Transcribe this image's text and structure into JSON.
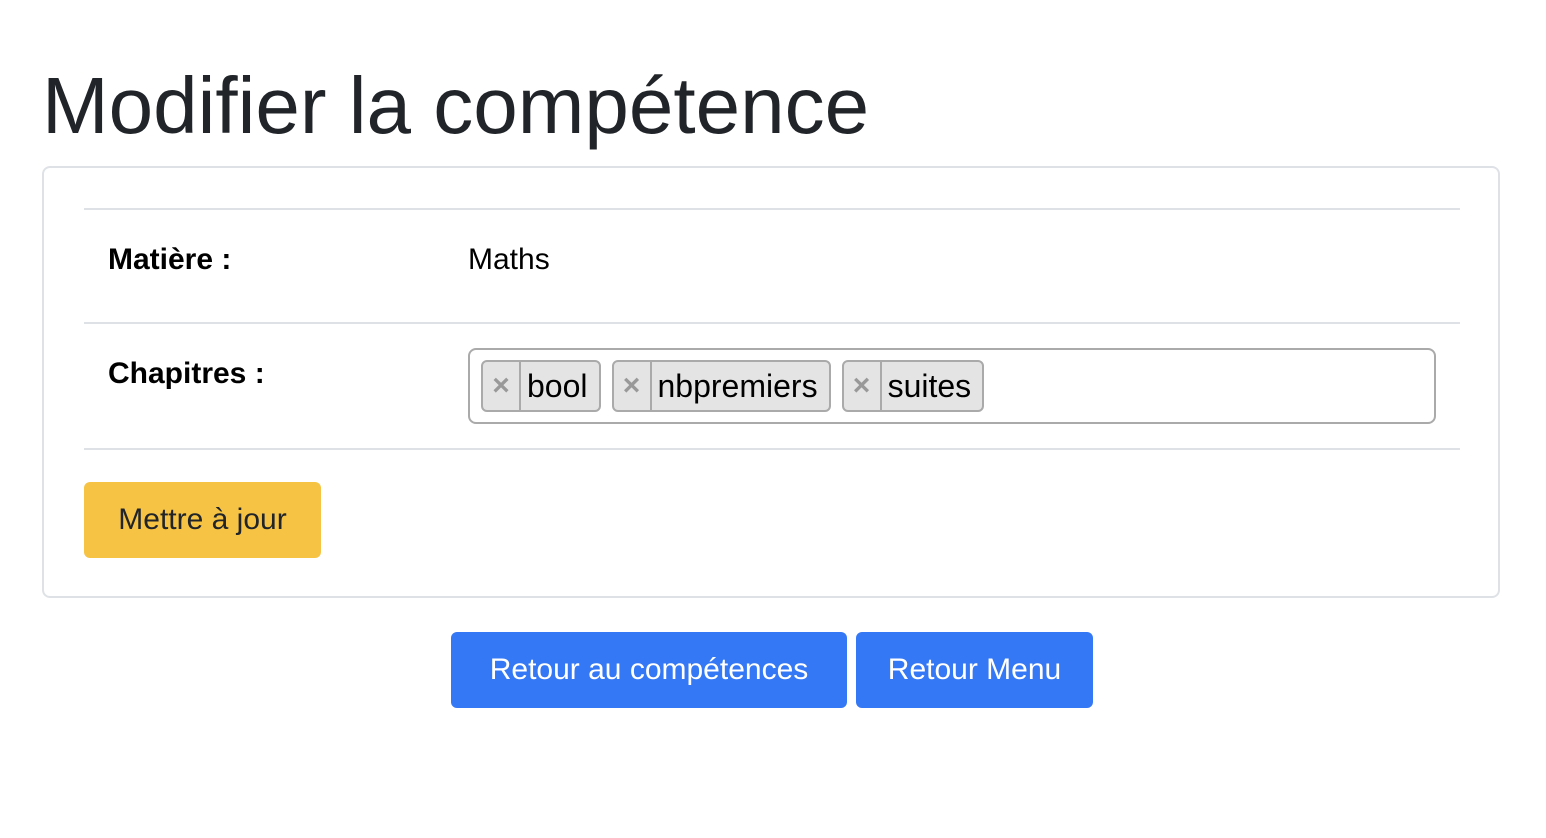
{
  "page": {
    "title": "Modifier la compétence"
  },
  "form": {
    "subject_label": "Matière :",
    "subject_value": "Maths",
    "chapters_label": "Chapitres :",
    "chapters": [
      {
        "label": "bool",
        "remove": "×"
      },
      {
        "label": "nbpremiers",
        "remove": "×"
      },
      {
        "label": "suites",
        "remove": "×"
      }
    ],
    "update_label": "Mettre à jour"
  },
  "footer": {
    "back_competences_label": "Retour au compétences",
    "back_menu_label": "Retour Menu"
  },
  "colors": {
    "warning": "#f6c344",
    "primary": "#3478f6",
    "border": "#dee2e6"
  }
}
